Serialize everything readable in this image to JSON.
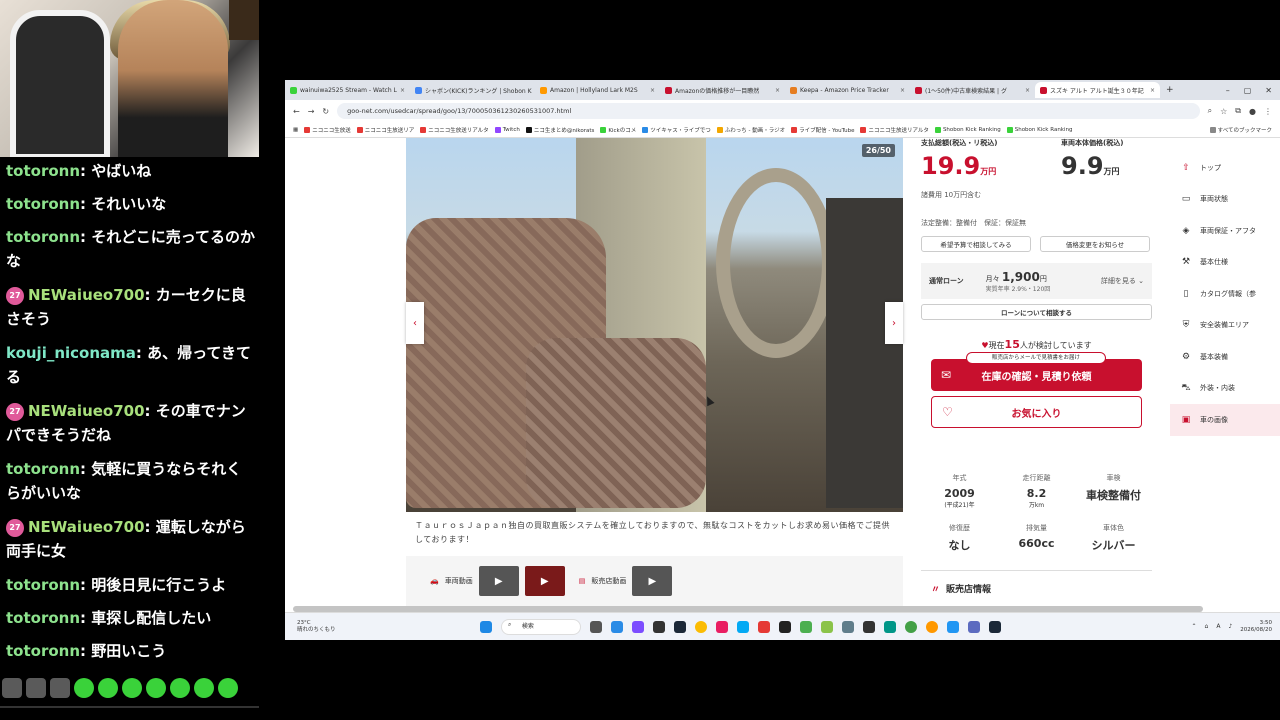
{
  "chat": {
    "messages": [
      {
        "user": "totoronn",
        "sep": ": ",
        "text": "やばいね",
        "color": "#8de28d",
        "badge": ""
      },
      {
        "user": "totoronn",
        "sep": ": ",
        "text": "それいいな",
        "color": "#8de28d",
        "badge": ""
      },
      {
        "user": "totoronn",
        "sep": ": ",
        "text": "それどこに売ってるのかな",
        "color": "#8de28d",
        "badge": ""
      },
      {
        "user": "NEWaiueo700",
        "sep": ": ",
        "text": "カーセクに良さそう",
        "color": "#a8e07c",
        "badge": "27"
      },
      {
        "user": "kouji_niconama",
        "sep": ": ",
        "text": "あ、帰ってきてる",
        "color": "#7fe7c7",
        "badge": ""
      },
      {
        "user": "NEWaiueo700",
        "sep": ": ",
        "text": "その車でナンパできそうだね",
        "color": "#a8e07c",
        "badge": "27"
      },
      {
        "user": "totoronn",
        "sep": ": ",
        "text": "気軽に買うならそれくらがいいな",
        "color": "#8de28d",
        "badge": ""
      },
      {
        "user": "NEWaiueo700",
        "sep": ": ",
        "text": "運転しながら両手に女",
        "color": "#a8e07c",
        "badge": "27"
      },
      {
        "user": "totoronn",
        "sep": ": ",
        "text": "明後日見に行こうよ",
        "color": "#8de28d",
        "badge": ""
      },
      {
        "user": "totoronn",
        "sep": ": ",
        "text": "車探し配信したい",
        "color": "#8de28d",
        "badge": ""
      },
      {
        "user": "totoronn",
        "sep": ": ",
        "text": "野田いこう",
        "color": "#8de28d",
        "badge": ""
      }
    ]
  },
  "browser": {
    "tabs": [
      {
        "title": "wainuiwa2525 Stream - Watch L",
        "color": "#3ad23a"
      },
      {
        "title": "シャボン(KICK)ランキング | Shobon K",
        "color": "#4285f4"
      },
      {
        "title": "Amazon | Hollyland Lark M2S",
        "color": "#ff9900"
      },
      {
        "title": "Amazonの価格推移が一目瞭然",
        "color": "#c8102e"
      },
      {
        "title": "Keepa - Amazon Price Tracker",
        "color": "#e67e22"
      },
      {
        "title": "(1～50件)中古車検索結果 | グ",
        "color": "#c8102e"
      },
      {
        "title": "スズキ アルト アルト誕生３０年記",
        "color": "#c8102e"
      }
    ],
    "url": "goo-net.com/usedcar/spread/goo/13/700050361230260531007.html",
    "bookmarks": [
      "ニコニコ生放送",
      "ニコニコ生放送リア",
      "ニコニコ生放送リアルタ",
      "Twitch",
      "ニコ生まとめ@nikorats",
      "Kickのコメ",
      "ツイキャス・ライブでつ",
      "ふわっち - 動画・ラジオ",
      "ライブ配信 - YouTube",
      "ニコニコ生放送リアルタ",
      "Shobon Kick Ranking",
      "Shobon Kick Ranking"
    ],
    "bookmarks_other": "すべてのブックマーク"
  },
  "listing": {
    "photo_counter": "26/50",
    "description": "ＴａｕｒｏｓＪａｐａｎ独自の買取直販システムを確立しておりますので、無駄なコストをカットしお求め易い価格でご提供しております！",
    "movie_label": "車両動画",
    "store_movie_label": "販売店動画",
    "total_price_label": "支払総額(税込・リ税込)",
    "total_price": "19.9",
    "body_price_label": "車両本体価格(税込)",
    "body_price": "9.9",
    "price_unit": "万円",
    "expense_note": "諸費用 10万円含む",
    "warranty_note": "法定整備：整備付　保証：保証無",
    "btn_consult": "希望予算で相談してみる",
    "btn_price_alert": "価格変更をお知らせ",
    "loan_label": "通常ローン",
    "loan_monthly_prefix": "月々",
    "loan_monthly": "1,900",
    "loan_unit": "円",
    "loan_detail": "実質年率 2.9%・120回",
    "loan_more": "詳細を見る",
    "loan_consult": "ローンについて相談する",
    "watchers_pre": "現在",
    "watchers": "15",
    "watchers_post": "人が検討しています",
    "email_note": "販売店からメールで見積書をお届け",
    "cta_estimate": "在庫の確認・見積り依頼",
    "cta_favorite": "お気に入り",
    "specs": [
      {
        "label": "年式",
        "value": "2009",
        "sub": "(平成21)年"
      },
      {
        "label": "走行距離",
        "value": "8.2",
        "sub": "万km"
      },
      {
        "label": "車検",
        "value": "車検整備付",
        "sub": ""
      },
      {
        "label": "修復歴",
        "value": "なし",
        "sub": ""
      },
      {
        "label": "排気量",
        "value": "660cc",
        "sub": ""
      },
      {
        "label": "車体色",
        "value": "シルバー",
        "sub": ""
      }
    ],
    "dealer_info": "販売店情報"
  },
  "sidemenu": {
    "items": [
      {
        "label": "トップ",
        "icon": "up-arrow-icon"
      },
      {
        "label": "車両状態",
        "icon": "car-icon"
      },
      {
        "label": "車両保証・アフタ",
        "icon": "shield-icon"
      },
      {
        "label": "基本仕様",
        "icon": "wrench-icon"
      },
      {
        "label": "カタログ情報（参",
        "icon": "document-icon"
      },
      {
        "label": "安全装備エリア",
        "icon": "shield-check-icon"
      },
      {
        "label": "基本装備",
        "icon": "gear-icon"
      },
      {
        "label": "外装・内装",
        "icon": "car-side-icon"
      },
      {
        "label": "車の画像",
        "icon": "image-icon"
      }
    ]
  },
  "taskbar": {
    "weather_temp": "23°C",
    "weather_text": "晴れのちくもり",
    "search_placeholder": "検索",
    "time": "3:50",
    "date": "2026/08/20",
    "ime": "A"
  },
  "colors": {
    "accent": "#c8102e",
    "chat_bg": "#000000"
  }
}
